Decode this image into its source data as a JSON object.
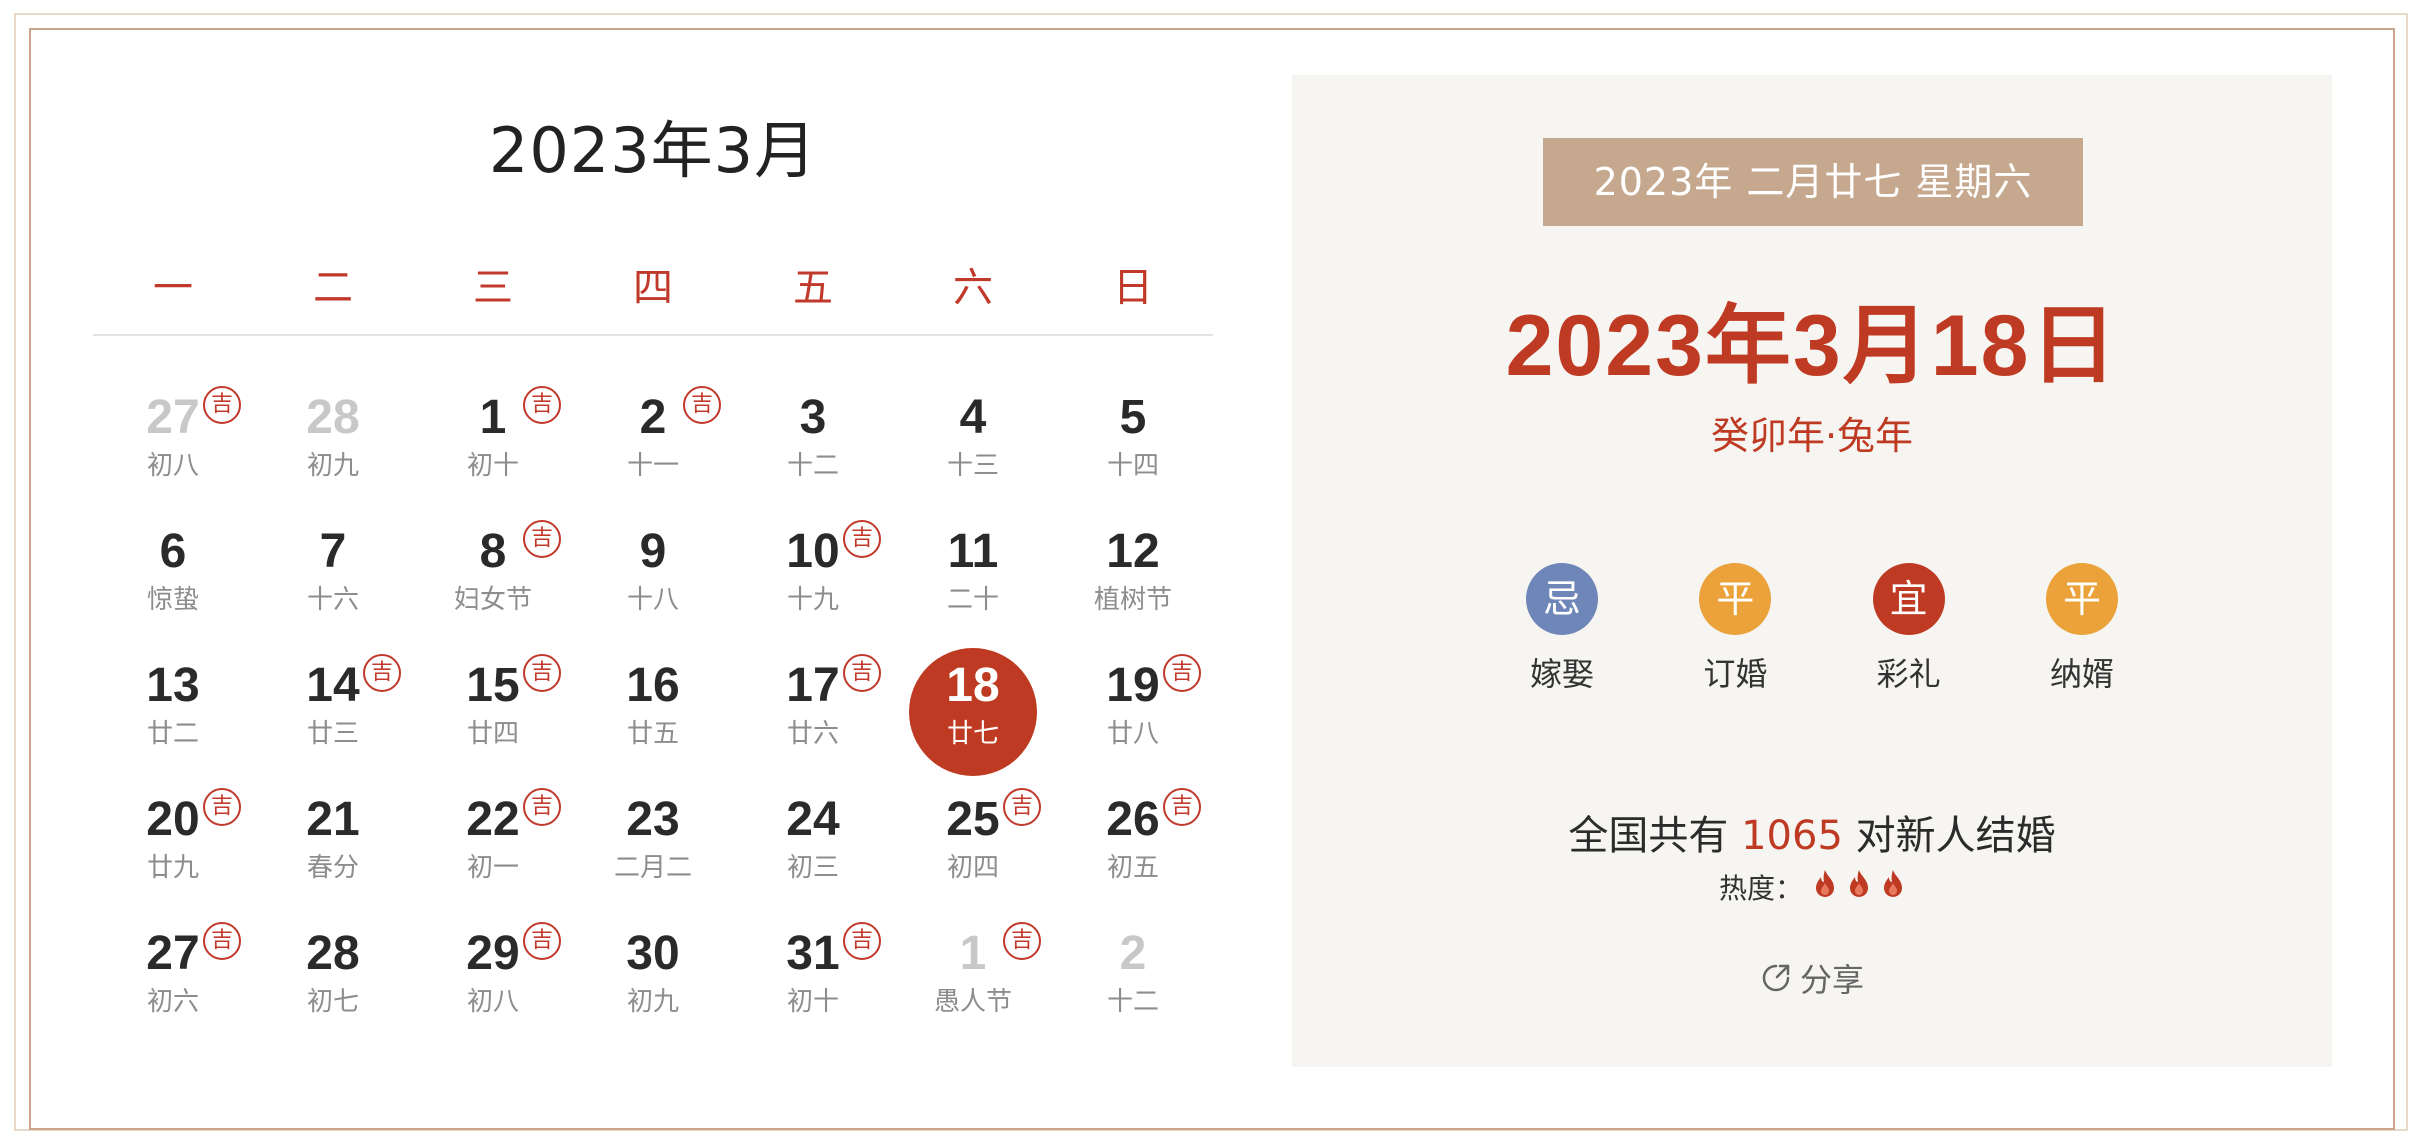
{
  "calendar": {
    "title": "2023年3月",
    "weekdays": [
      "一",
      "二",
      "三",
      "四",
      "五",
      "六",
      "日"
    ],
    "days": [
      {
        "day": "27",
        "lunar": "初八",
        "other": true,
        "ji": true
      },
      {
        "day": "28",
        "lunar": "初九",
        "other": true,
        "ji": false
      },
      {
        "day": "1",
        "lunar": "初十",
        "other": false,
        "ji": true
      },
      {
        "day": "2",
        "lunar": "十一",
        "other": false,
        "ji": true
      },
      {
        "day": "3",
        "lunar": "十二",
        "other": false,
        "ji": false
      },
      {
        "day": "4",
        "lunar": "十三",
        "other": false,
        "ji": false
      },
      {
        "day": "5",
        "lunar": "十四",
        "other": false,
        "ji": false
      },
      {
        "day": "6",
        "lunar": "惊蛰",
        "other": false,
        "ji": false
      },
      {
        "day": "7",
        "lunar": "十六",
        "other": false,
        "ji": false
      },
      {
        "day": "8",
        "lunar": "妇女节",
        "other": false,
        "ji": true
      },
      {
        "day": "9",
        "lunar": "十八",
        "other": false,
        "ji": false
      },
      {
        "day": "10",
        "lunar": "十九",
        "other": false,
        "ji": true
      },
      {
        "day": "11",
        "lunar": "二十",
        "other": false,
        "ji": false
      },
      {
        "day": "12",
        "lunar": "植树节",
        "other": false,
        "ji": false
      },
      {
        "day": "13",
        "lunar": "廿二",
        "other": false,
        "ji": false
      },
      {
        "day": "14",
        "lunar": "廿三",
        "other": false,
        "ji": true
      },
      {
        "day": "15",
        "lunar": "廿四",
        "other": false,
        "ji": true
      },
      {
        "day": "16",
        "lunar": "廿五",
        "other": false,
        "ji": false
      },
      {
        "day": "17",
        "lunar": "廿六",
        "other": false,
        "ji": true
      },
      {
        "day": "18",
        "lunar": "廿七",
        "other": false,
        "ji": false,
        "selected": true
      },
      {
        "day": "19",
        "lunar": "廿八",
        "other": false,
        "ji": true
      },
      {
        "day": "20",
        "lunar": "廿九",
        "other": false,
        "ji": true
      },
      {
        "day": "21",
        "lunar": "春分",
        "other": false,
        "ji": false
      },
      {
        "day": "22",
        "lunar": "初一",
        "other": false,
        "ji": true
      },
      {
        "day": "23",
        "lunar": "二月二",
        "other": false,
        "ji": false
      },
      {
        "day": "24",
        "lunar": "初三",
        "other": false,
        "ji": false
      },
      {
        "day": "25",
        "lunar": "初四",
        "other": false,
        "ji": true
      },
      {
        "day": "26",
        "lunar": "初五",
        "other": false,
        "ji": true
      },
      {
        "day": "27",
        "lunar": "初六",
        "other": false,
        "ji": true
      },
      {
        "day": "28",
        "lunar": "初七",
        "other": false,
        "ji": false
      },
      {
        "day": "29",
        "lunar": "初八",
        "other": false,
        "ji": true
      },
      {
        "day": "30",
        "lunar": "初九",
        "other": false,
        "ji": false
      },
      {
        "day": "31",
        "lunar": "初十",
        "other": false,
        "ji": true
      },
      {
        "day": "1",
        "lunar": "愚人节",
        "other": true,
        "ji": true
      },
      {
        "day": "2",
        "lunar": "十二",
        "other": true,
        "ji": false
      }
    ],
    "ji_label": "吉"
  },
  "detail": {
    "date_tag": "2023年  二月廿七  星期六",
    "big_date": "2023年3月18日",
    "ganzhi": "癸卯年·兔年",
    "items": [
      {
        "badge": "忌",
        "label": "嫁娶",
        "color": "#6f86b8"
      },
      {
        "badge": "平",
        "label": "订婚",
        "color": "#eba23a"
      },
      {
        "badge": "宜",
        "label": "彩礼",
        "color": "#bf3a22"
      },
      {
        "badge": "平",
        "label": "纳婿",
        "color": "#eba23a"
      }
    ],
    "stat_prefix": "全国共有",
    "stat_count": "1065",
    "stat_suffix": "对新人结婚",
    "heat_label": "热度：",
    "heat_level": 3,
    "share_label": "分享"
  },
  "colors": {
    "accent": "#bf3a22",
    "tag_bg": "#c5a88d",
    "panel_bg": "#f7f5f2"
  }
}
